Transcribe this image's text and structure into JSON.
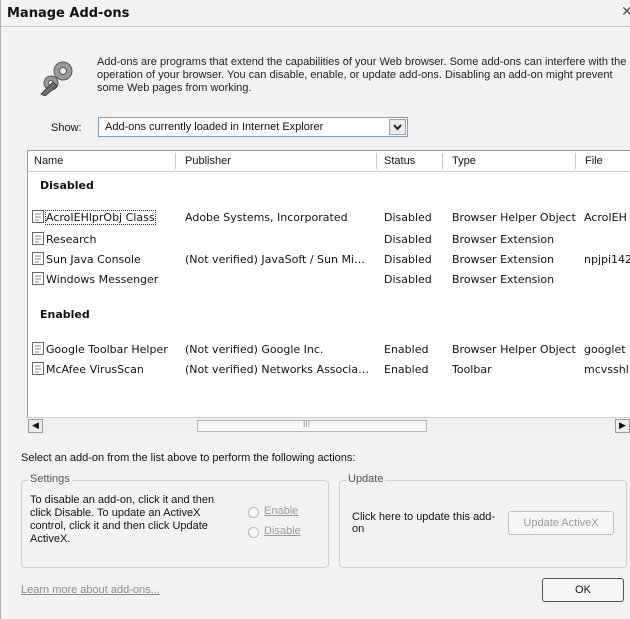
{
  "window": {
    "title": "Manage Add-ons",
    "close_glyph": "✕"
  },
  "intro_text": "Add-ons are programs that extend the capabilities of your Web browser. Some add-ons can interfere with the operation of your browser. You can disable, enable, or update add-ons. Disabling an add-on might prevent some Web pages from working.",
  "show": {
    "label": "Show:",
    "selected": "Add-ons currently loaded in Internet Explorer"
  },
  "columns": [
    "Name",
    "Publisher",
    "Status",
    "Type",
    "File"
  ],
  "groups": [
    {
      "name": "Disabled",
      "rows": [
        {
          "name": "AcroIEHlprObj Class",
          "publisher": "Adobe Systems, Incorporated",
          "status": "Disabled",
          "type": "Browser Helper Object",
          "file": "AcroIEH"
        },
        {
          "name": "Research",
          "publisher": "",
          "status": "Disabled",
          "type": "Browser Extension",
          "file": ""
        },
        {
          "name": "Sun Java Console",
          "publisher": "(Not verified) JavaSoft / Sun Mi…",
          "status": "Disabled",
          "type": "Browser Extension",
          "file": "npjpi142"
        },
        {
          "name": "Windows Messenger",
          "publisher": "",
          "status": "Disabled",
          "type": "Browser Extension",
          "file": ""
        }
      ]
    },
    {
      "name": "Enabled",
      "rows": [
        {
          "name": "Google Toolbar Helper",
          "publisher": "(Not verified) Google Inc.",
          "status": "Enabled",
          "type": "Browser Helper Object",
          "file": "googlet"
        },
        {
          "name": "McAfee VirusScan",
          "publisher": "(Not verified) Networks Associa…",
          "status": "Enabled",
          "type": "Toolbar",
          "file": "mcvsshl"
        }
      ]
    }
  ],
  "scrollbar": {
    "left_glyph": "◀",
    "right_glyph": "▶",
    "thumb_glyph": "III"
  },
  "actions_prompt": "Select an add-on from the list above to perform the following actions:",
  "settings": {
    "legend": "Settings",
    "text": "To disable an add-on, click it and then click Disable. To update an ActiveX control, click it and then click Update ActiveX.",
    "enable_label": "Enable",
    "disable_label": "Disable"
  },
  "update": {
    "legend": "Update",
    "text": "Click here to update this add-on",
    "button_label": "Update ActiveX"
  },
  "learn_more": "Learn more about add-ons...",
  "ok_label": "OK"
}
